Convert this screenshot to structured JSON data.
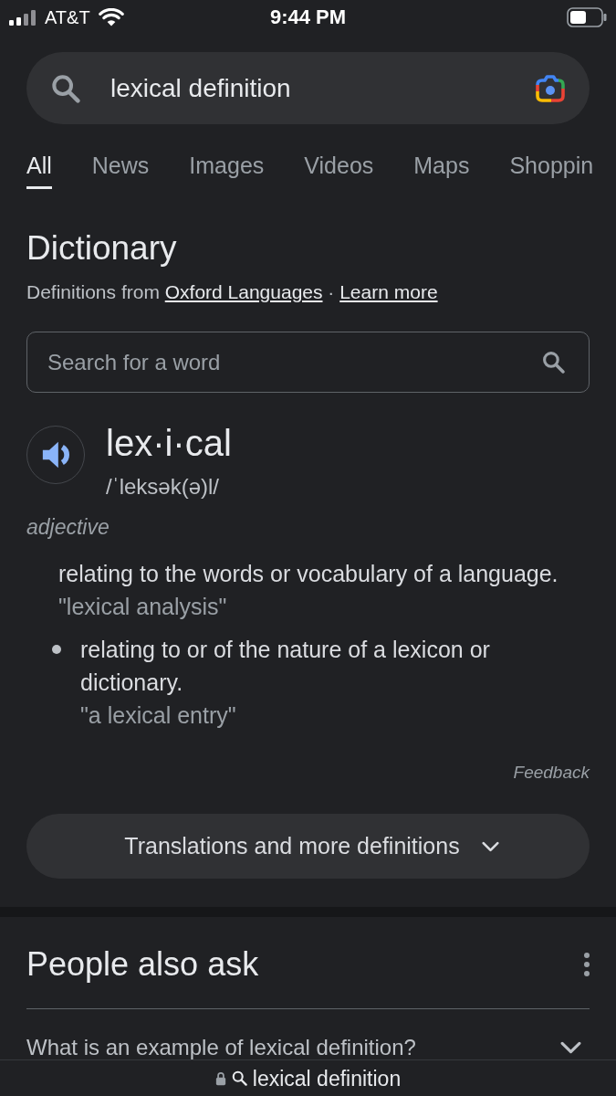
{
  "status_bar": {
    "carrier": "AT&T",
    "time": "9:44 PM"
  },
  "search_bar": {
    "value": "lexical definition"
  },
  "tabs": [
    {
      "label": "All",
      "selected": true
    },
    {
      "label": "News",
      "selected": false
    },
    {
      "label": "Images",
      "selected": false
    },
    {
      "label": "Videos",
      "selected": false
    },
    {
      "label": "Maps",
      "selected": false
    },
    {
      "label": "Shoppin",
      "selected": false
    }
  ],
  "dictionary": {
    "title": "Dictionary",
    "source": {
      "prefix": "Definitions from",
      "link": "Oxford Languages",
      "separator": "·",
      "learn_more": "Learn more"
    },
    "search": {
      "placeholder": "Search for a word"
    },
    "headword": "lex·i·cal",
    "pronunciation": "/ˈleksək(ə)l/",
    "part_of_speech": "adjective",
    "senses": [
      {
        "kind": "main",
        "definition": "relating to the words or vocabulary of a language.",
        "example": "\"lexical analysis\""
      },
      {
        "kind": "sub",
        "definition": "relating to or of the nature of a lexicon or dictionary.",
        "example": "\"a lexical entry\""
      }
    ],
    "feedback": "Feedback",
    "more_button": "Translations and more definitions"
  },
  "people_also_ask": {
    "title": "People also ask",
    "questions": [
      {
        "text": "What is an example of lexical definition?",
        "expanded": false
      }
    ]
  },
  "address_bar": {
    "text": "lexical definition"
  }
}
